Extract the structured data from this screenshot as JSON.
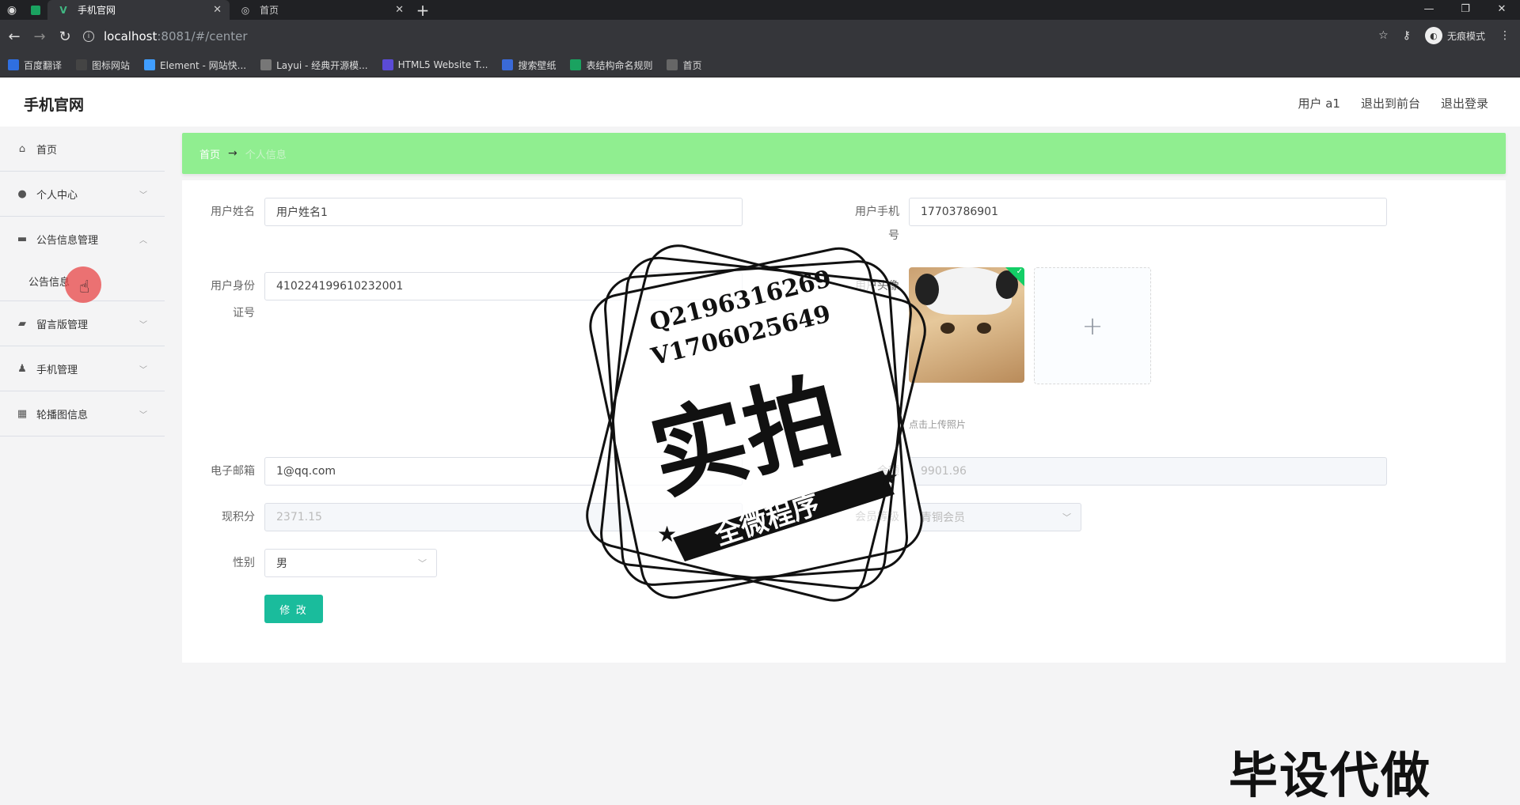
{
  "browser": {
    "tabs": [
      {
        "title": "手机官网",
        "active": true
      },
      {
        "title": "首页",
        "active": false
      }
    ],
    "url_host": "localhost",
    "url_path": ":8081/#/center",
    "incognito_label": "无痕模式",
    "bookmarks": [
      {
        "label": "百度翻译",
        "icon": "translate-icon",
        "color": "#2f6fe0"
      },
      {
        "label": "图标网站",
        "icon": "flag-icon",
        "color": "#444444"
      },
      {
        "label": "Element - 网站快...",
        "icon": "element-icon",
        "color": "#409eff"
      },
      {
        "label": "Layui - 经典开源模...",
        "icon": "layui-icon",
        "color": "#777777"
      },
      {
        "label": "HTML5 Website T...",
        "icon": "html5-icon",
        "color": "#5b4bd6"
      },
      {
        "label": "搜索壁纸",
        "icon": "wallpaper-icon",
        "color": "#3a6ad8"
      },
      {
        "label": "表结构命名规则",
        "icon": "table-icon",
        "color": "#1aa260"
      },
      {
        "label": "首页",
        "icon": "globe-icon",
        "color": "#666666"
      }
    ]
  },
  "app": {
    "brand": "手机官网",
    "top_links": [
      "用户 a1",
      "退出到前台",
      "退出登录"
    ]
  },
  "sidebar": {
    "items": [
      {
        "label": "首页",
        "icon": "home-icon",
        "has_chevron": false
      },
      {
        "label": "个人中心",
        "icon": "user-icon",
        "has_chevron": true
      },
      {
        "label": "公告信息管理",
        "icon": "notice-icon",
        "has_chevron": true,
        "expanded": true
      },
      {
        "label": "留言版管理",
        "icon": "message-icon",
        "has_chevron": true
      },
      {
        "label": "手机管理",
        "icon": "phone-user-icon",
        "has_chevron": true
      },
      {
        "label": "轮播图信息",
        "icon": "grid-icon",
        "has_chevron": true
      }
    ],
    "submenu_label": "公告信息"
  },
  "breadcrumb": {
    "home": "首页",
    "separator": "→",
    "current": "个人信息"
  },
  "form": {
    "name_label": "用户姓名",
    "name_value": "用户姓名1",
    "phone_label_line1": "用户手机",
    "phone_label_line2": "号",
    "phone_value": "17703786901",
    "id_label_line1": "用户身份",
    "id_label_line2": "证号",
    "id_value": "410224199610232001",
    "avatar_label": "用户头像",
    "upload_hint": "点击上传照片",
    "email_label": "电子邮箱",
    "email_value": "1@qq.com",
    "balance_label": "余额",
    "balance_value": "9901.96",
    "points_label": "现积分",
    "points_value": "2371.15",
    "level_label": "会员等级",
    "level_value": "青铜会员",
    "gender_label": "性别",
    "gender_value": "男",
    "submit_label": "修 改"
  },
  "watermark": {
    "qq": "Q2196316269",
    "wechat": "V1706025649",
    "big": "实拍",
    "banner": "全微程序",
    "corner": "毕设代做"
  },
  "colors": {
    "breadcrumb_bg": "#90ee90",
    "submit_bg": "#1abc9c"
  }
}
